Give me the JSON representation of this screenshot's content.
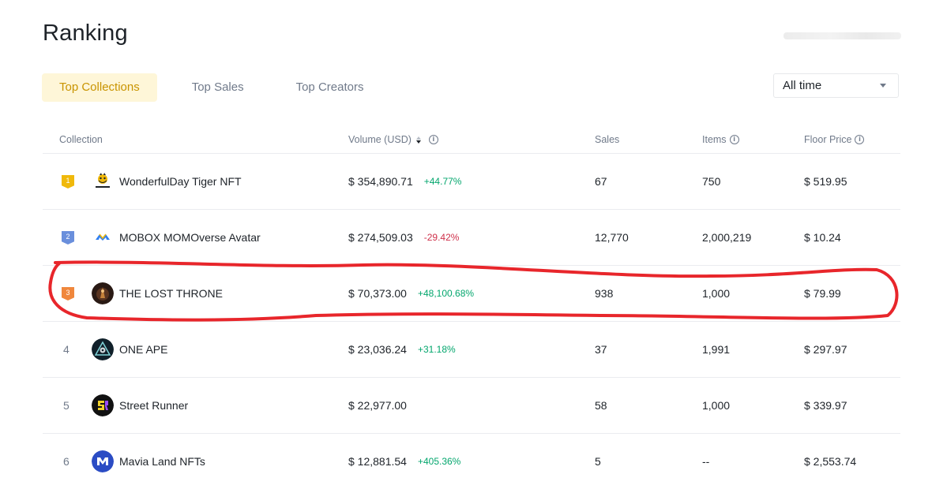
{
  "page": {
    "title": "Ranking"
  },
  "tabs": [
    {
      "label": "Top Collections",
      "active": true
    },
    {
      "label": "Top Sales",
      "active": false
    },
    {
      "label": "Top Creators",
      "active": false
    }
  ],
  "time_filter": {
    "selected": "All time"
  },
  "table": {
    "headers": {
      "collection": "Collection",
      "volume": "Volume (USD)",
      "sales": "Sales",
      "items": "Items",
      "floor": "Floor Price"
    },
    "rows": [
      {
        "rank": "1",
        "name": "WonderfulDay Tiger NFT",
        "volume": "$ 354,890.71",
        "change": "+44.77%",
        "sales": "67",
        "items": "750",
        "floor": "$ 519.95",
        "badge_color": "#f0b90b",
        "avatar": "tiger-logo"
      },
      {
        "rank": "2",
        "name": "MOBOX MOMOverse Avatar",
        "volume": "$ 274,509.03",
        "change": "-29.42%",
        "sales": "12,770",
        "items": "2,000,219",
        "floor": "$ 10.24",
        "badge_color": "#6a8fdc",
        "avatar": "mobox-logo"
      },
      {
        "rank": "3",
        "name": "THE LOST THRONE",
        "volume": "$ 70,373.00",
        "change": "+48,100.68%",
        "sales": "938",
        "items": "1,000",
        "floor": "$ 79.99",
        "badge_color": "#f0873c",
        "avatar": "throne-logo"
      },
      {
        "rank": "4",
        "name": "ONE APE",
        "volume": "$ 23,036.24",
        "change": "+31.18%",
        "sales": "37",
        "items": "1,991",
        "floor": "$ 297.97",
        "avatar": "one-ape-logo"
      },
      {
        "rank": "5",
        "name": "Street Runner",
        "volume": "$ 22,977.00",
        "change": "",
        "sales": "58",
        "items": "1,000",
        "floor": "$ 339.97",
        "avatar": "street-runner-logo"
      },
      {
        "rank": "6",
        "name": "Mavia Land NFTs",
        "volume": "$ 12,881.54",
        "change": "+405.36%",
        "sales": "5",
        "items": "--",
        "floor": "$ 2,553.74",
        "avatar": "mavia-logo"
      }
    ]
  },
  "colors": {
    "accent": "#f0b90b",
    "active_tab_bg": "#fef6d8",
    "active_tab_text": "#c99400",
    "positive": "#03a66d",
    "negative": "#cf304a",
    "annotation": "#e8262b"
  }
}
